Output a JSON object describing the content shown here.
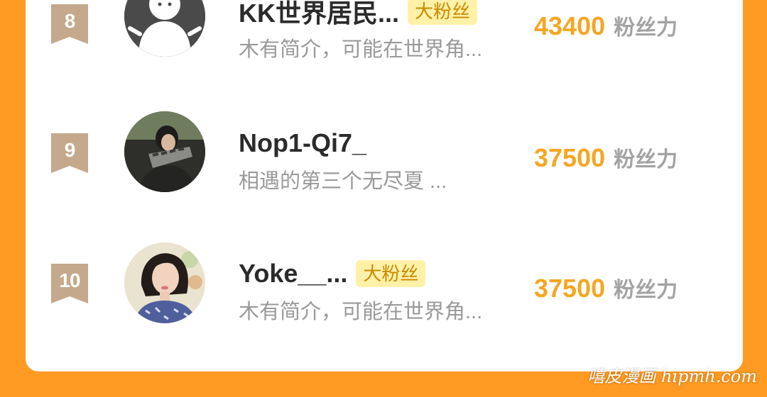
{
  "colors": {
    "background": "#ff9a23",
    "card": "#ffffff",
    "score": "#f5a623",
    "tag_bg": "#fff1a8",
    "tag_text": "#c98a00",
    "rank_badge": "#c4a98c"
  },
  "ranking": {
    "items": [
      {
        "rank": "8",
        "name": "KK世界居民...",
        "tag": "大粉丝",
        "bio": "木有简介，可能在世界角...",
        "score": "43400",
        "unit": "粉丝力",
        "avatar_icon": "default-avatar-icon"
      },
      {
        "rank": "9",
        "name": "Nop1-Qi7_",
        "tag": "",
        "bio": "相遇的第三个无尽夏 ...",
        "score": "37500",
        "unit": "粉丝力",
        "avatar_icon": "user-photo"
      },
      {
        "rank": "10",
        "name": "Yoke__...",
        "tag": "大粉丝",
        "bio": "木有简介，可能在世界角...",
        "score": "37500",
        "unit": "粉丝力",
        "avatar_icon": "user-photo"
      }
    ]
  },
  "watermark": "嘻皮漫画 hipmh.com"
}
